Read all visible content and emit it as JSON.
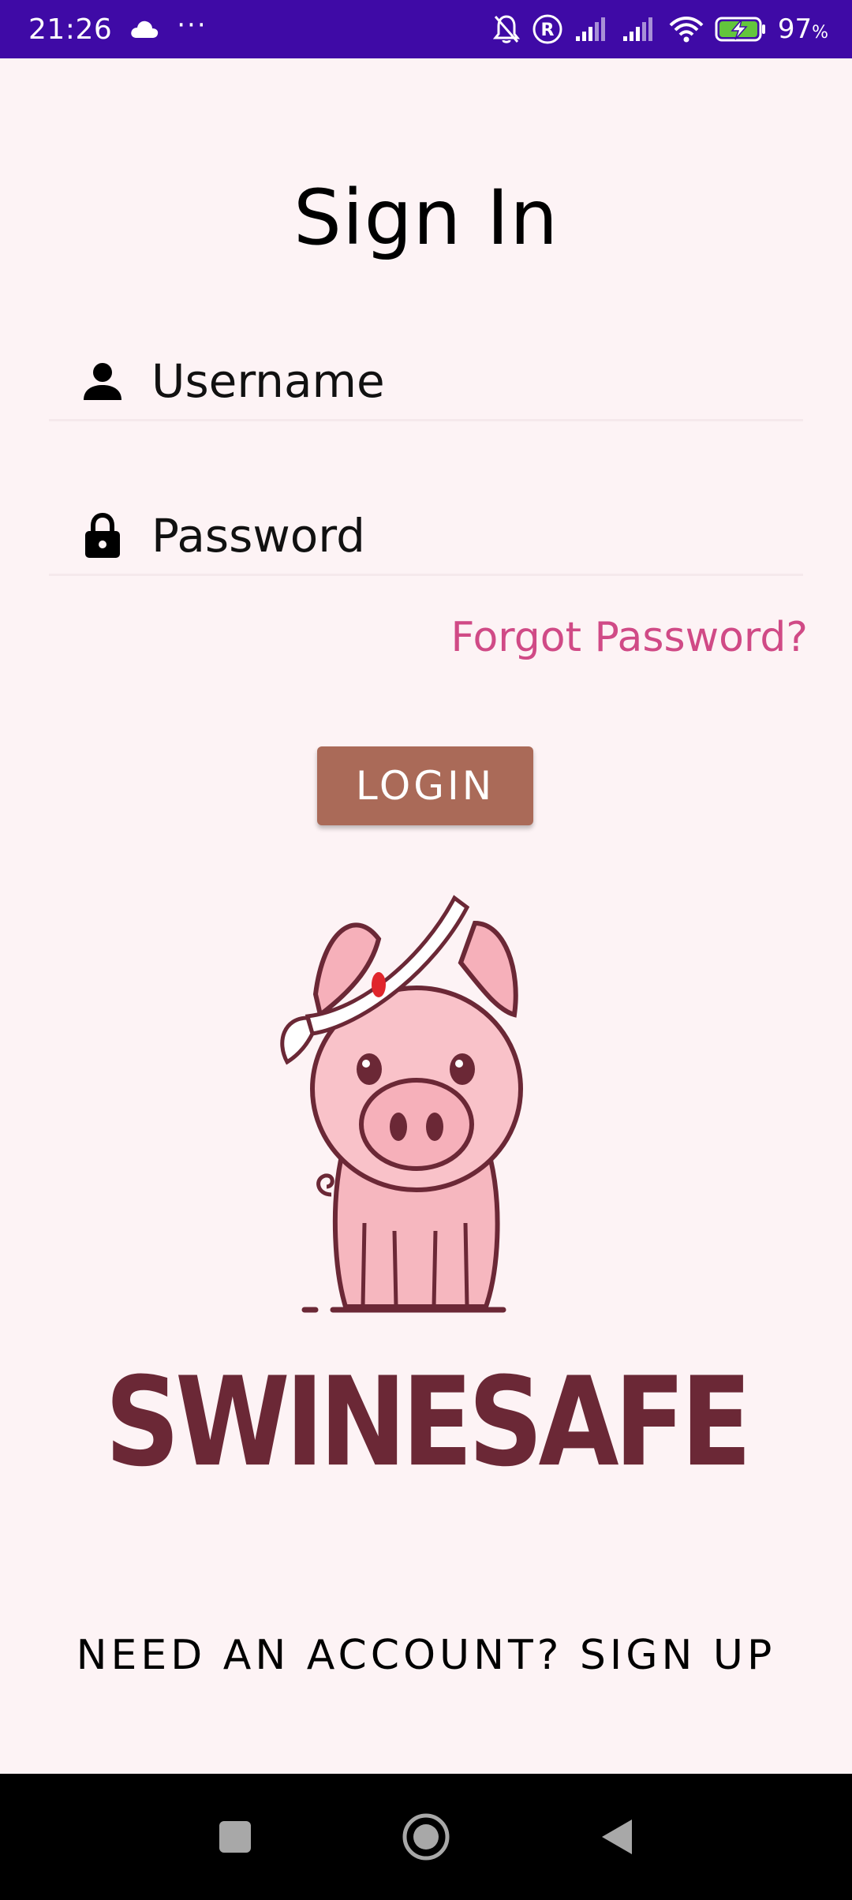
{
  "status_bar": {
    "time": "21:26",
    "dots": "···",
    "battery_percent": "97",
    "battery_unit": "%",
    "icons": [
      "cloud-icon",
      "mute-bell-icon",
      "registered-icon",
      "signal-icon",
      "signal-icon",
      "wifi-icon",
      "battery-charging-icon"
    ]
  },
  "page": {
    "title": "Sign In"
  },
  "form": {
    "username_placeholder": "Username",
    "username_value": "",
    "password_placeholder": "Password",
    "password_value": "",
    "forgot_label": "Forgot Password?",
    "login_label": "LOGIN"
  },
  "brand": {
    "name": "SWINESAFE"
  },
  "footer": {
    "signup_label": "NEED AN ACCOUNT? SIGN UP"
  },
  "colors": {
    "status_bar": "#3f0aa6",
    "background": "#fdf3f5",
    "accent_link": "#d04a86",
    "button": "#aa6a58",
    "brand": "#6b2836"
  }
}
